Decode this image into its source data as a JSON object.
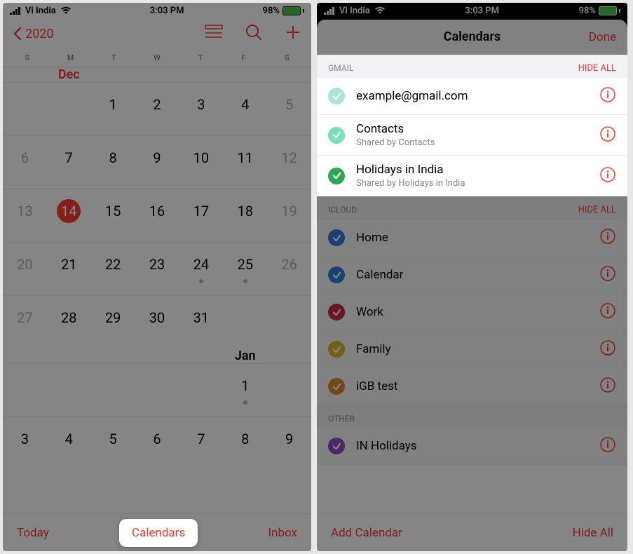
{
  "status": {
    "carrier": "Vi India",
    "time": "3:03 PM",
    "battery_pct": "98%"
  },
  "left": {
    "back_year": "2020",
    "day_initials": [
      "S",
      "M",
      "T",
      "W",
      "T",
      "F",
      "S"
    ],
    "dec_label": "Dec",
    "jan_label": "Jan",
    "rows_dec": [
      [
        "",
        "",
        "1",
        "2",
        "3",
        "4",
        "5"
      ],
      [
        "6",
        "7",
        "8",
        "9",
        "10",
        "11",
        "12"
      ],
      [
        "13",
        "14",
        "15",
        "16",
        "17",
        "18",
        "19"
      ],
      [
        "20",
        "21",
        "22",
        "23",
        "24",
        "25",
        "26"
      ],
      [
        "27",
        "28",
        "29",
        "30",
        "31",
        "",
        ""
      ]
    ],
    "rows_jan": [
      [
        "",
        "",
        "",
        "",
        "",
        "1",
        ""
      ],
      [
        "3",
        "4",
        "5",
        "6",
        "7",
        "8",
        "9"
      ]
    ],
    "dot_cells": [
      "24",
      "25",
      "1j"
    ],
    "selected_day": "14",
    "muted_days": [
      "5",
      "12",
      "19",
      "26",
      "6",
      "13",
      "20",
      "27"
    ],
    "today_label": "Today",
    "calendars_label": "Calendars",
    "inbox_label": "Inbox"
  },
  "right": {
    "title": "Calendars",
    "done_label": "Done",
    "gmail_header": "GMAIL",
    "hide_all_label": "HIDE ALL",
    "icloud_header": "ICLOUD",
    "other_header": "OTHER",
    "gmail_items": [
      {
        "title": "example@gmail.com",
        "sub": "",
        "color": "#a8e6d9"
      },
      {
        "title": "Contacts",
        "sub": "Shared by Contacts",
        "color": "#7be0b8"
      },
      {
        "title": "Holidays in India",
        "sub": "Shared by Holidays in India",
        "color": "#2ea84f"
      }
    ],
    "icloud_items": [
      {
        "title": "Home",
        "color": "#2e7cd6"
      },
      {
        "title": "Calendar",
        "color": "#2e7cd6"
      },
      {
        "title": "Work",
        "color": "#cc2850"
      },
      {
        "title": "Family",
        "color": "#d6b82e"
      },
      {
        "title": "iGB test",
        "color": "#d68a2e"
      }
    ],
    "other_items": [
      {
        "title": "IN Holidays",
        "color": "#8e4ec6"
      }
    ],
    "add_calendar_label": "Add Calendar",
    "hide_all_bottom_label": "Hide All"
  }
}
